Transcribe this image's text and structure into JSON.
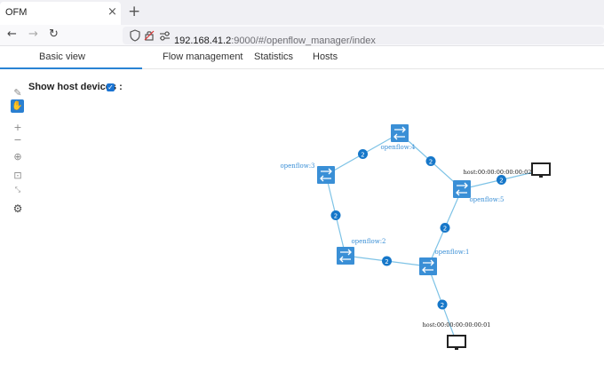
{
  "browser": {
    "tab_title": "OFM",
    "tab_close": "×",
    "new_tab": "+",
    "url_host": "192.168.41.2",
    "url_rest": ":9000/#/openflow_manager/index"
  },
  "app_nav": {
    "items": [
      "Basic view",
      "Flow management",
      "Statistics",
      "Hosts"
    ]
  },
  "show_host": {
    "label": "Show host devices :",
    "checked": true
  },
  "topology": {
    "switch_color": "#3a8fd6",
    "link_color": "#7ec3e6",
    "badge_color": "#1677c9",
    "switches": [
      {
        "id": "s4",
        "label": "openflow:4"
      },
      {
        "id": "s3",
        "label": "openflow:3"
      },
      {
        "id": "s5",
        "label": "openflow:5"
      },
      {
        "id": "s2",
        "label": "openflow:2"
      },
      {
        "id": "s1",
        "label": "openflow:1"
      }
    ],
    "hosts": [
      {
        "id": "h2",
        "label": "host:00:00:00:00:00:02"
      },
      {
        "id": "h1",
        "label": "host:00:00:00:00:00:01"
      }
    ],
    "links": [
      {
        "from": "s3",
        "to": "s4",
        "badge": "2"
      },
      {
        "from": "s4",
        "to": "s5",
        "badge": "2"
      },
      {
        "from": "s5",
        "to": "h2",
        "badge": "2"
      },
      {
        "from": "s3",
        "to": "s2",
        "badge": "2"
      },
      {
        "from": "s5",
        "to": "s1",
        "badge": "2"
      },
      {
        "from": "s2",
        "to": "s1",
        "badge": "2"
      },
      {
        "from": "s1",
        "to": "h1",
        "badge": "2"
      }
    ]
  }
}
